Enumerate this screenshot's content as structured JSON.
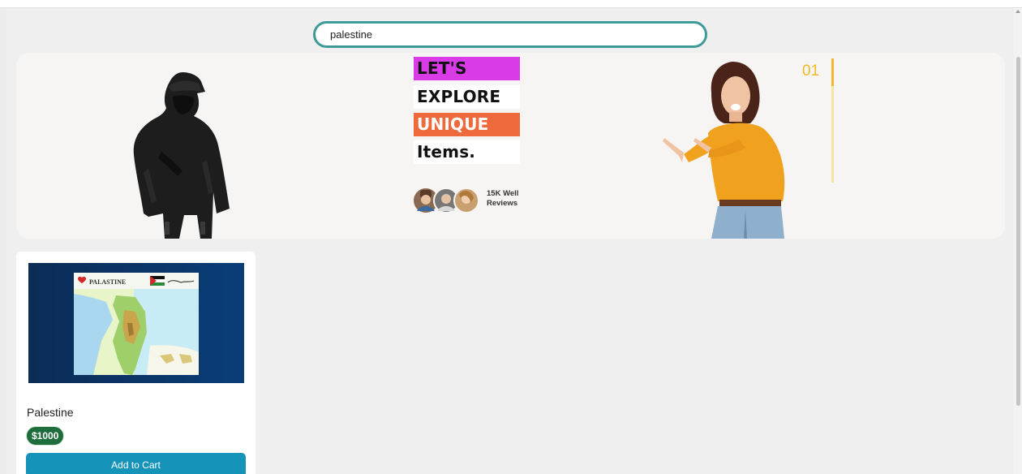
{
  "search": {
    "value": "palestine"
  },
  "hero": {
    "words": [
      "LET'S",
      "EXPLORE",
      "UNIQUE",
      "Items."
    ],
    "reviews_line1": "15K Well",
    "reviews_line2": "Reviews",
    "slide_number": "01"
  },
  "product": {
    "title": "Palestine",
    "price": "$1000",
    "add_to_cart_label": "Add to Cart",
    "image_caption": "PALASTINE"
  },
  "colors": {
    "accent_teal": "#3f9b98",
    "lets_bg": "#d93be6",
    "unique_bg": "#ee6a3c",
    "slide_accent": "#f0b929",
    "price_bg": "#1f6d3d",
    "button_bg": "#1593b8"
  }
}
